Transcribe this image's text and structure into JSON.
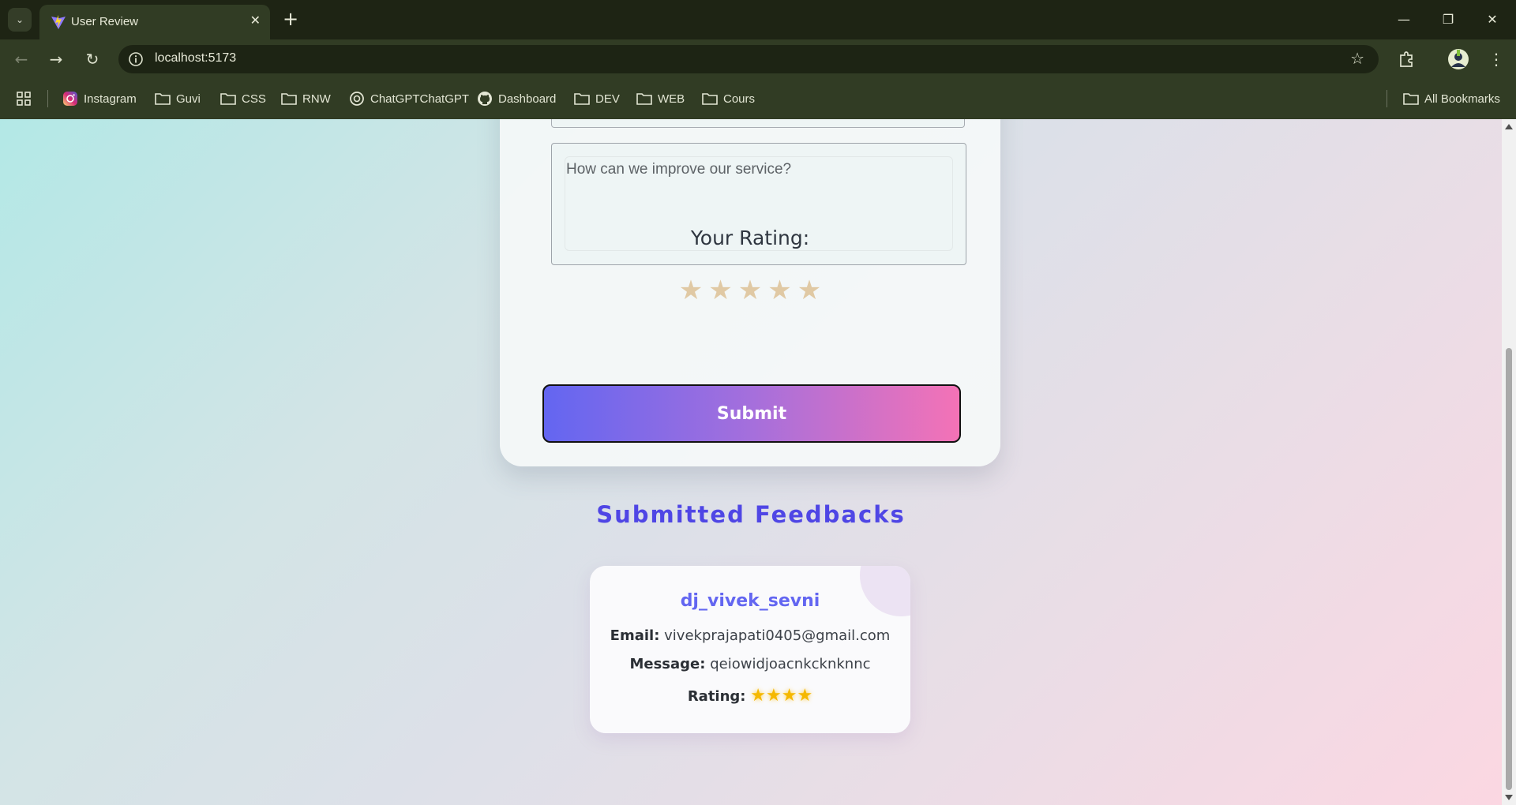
{
  "browser": {
    "tab_title": "User Review",
    "url": "localhost:5173",
    "bookmarks": [
      "Instagram",
      "Guvi",
      "CSS",
      "RNW",
      "ChatGPTChatGPT",
      "Dashboard",
      "DEV",
      "WEB",
      "Cours"
    ],
    "all_bookmarks_label": "All Bookmarks"
  },
  "form": {
    "message_placeholder": "How can we improve our service?",
    "rating_label": "Your Rating:",
    "rating_value": 0,
    "rating_max": 5,
    "submit_label": "Submit"
  },
  "feedbacks": {
    "heading": "Submitted Feedbacks",
    "items": [
      {
        "name": "dj_vivek_sevni",
        "email_label": "Email:",
        "email": "vivekprajapati0405@gmail.com",
        "message_label": "Message:",
        "message": "qeiowidjoacnkcknknnc",
        "rating_label": "Rating:",
        "rating": 4
      }
    ]
  },
  "colors": {
    "accent": "#4f46e5",
    "name_color": "#6366f1",
    "star_empty": "#e0c9a4",
    "star_filled": "#f5b800"
  }
}
